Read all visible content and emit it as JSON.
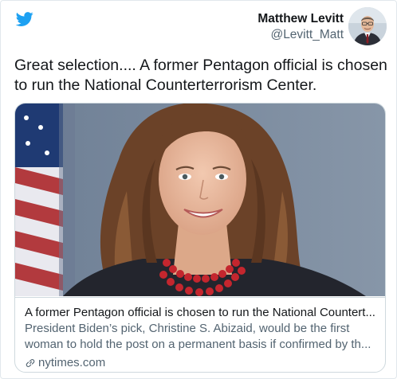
{
  "tweet": {
    "author_name": "Matthew Levitt",
    "author_handle": "@Levitt_Matt",
    "text": "Great selection....  A former Pentagon official is chosen to run the National Counterterrorism Center."
  },
  "link_card": {
    "title": "A former Pentagon official is chosen to run the National Countert...",
    "description": "President Biden’s pick, Christine S. Abizaid, would be the first woman to hold the post on a permanent basis if confirmed by th...",
    "source": "nytimes.com"
  },
  "icons": {
    "brand": "twitter-bird-icon",
    "source": "link-icon"
  },
  "colors": {
    "twitter_blue": "#1da1f2",
    "text_primary": "#14171a",
    "text_secondary": "#536471",
    "border": "#cfd9de"
  }
}
